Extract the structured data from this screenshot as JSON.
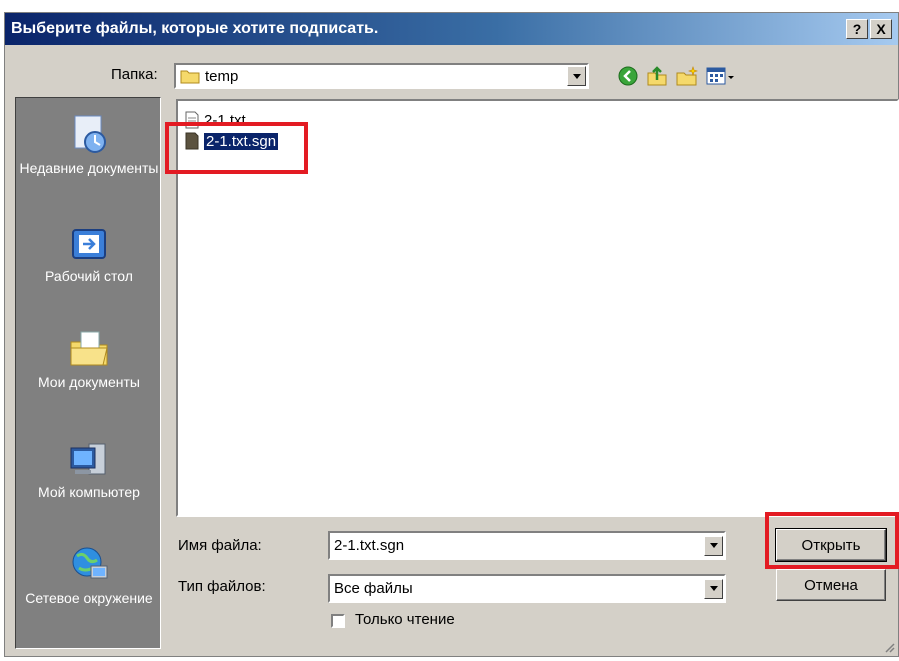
{
  "window": {
    "title": "Выберите файлы, которые хотите подписать.",
    "help": "?",
    "close": "X"
  },
  "toolbar": {
    "folder_label": "Папка:",
    "folder_value": "temp",
    "icons": [
      "back-icon",
      "up-folder-icon",
      "new-folder-icon",
      "view-menu-icon"
    ]
  },
  "places": [
    {
      "label": "Недавние документы",
      "icon": "recent-documents-icon"
    },
    {
      "label": "Рабочий стол",
      "icon": "desktop-icon"
    },
    {
      "label": "Мои документы",
      "icon": "my-documents-icon"
    },
    {
      "label": "Мой компьютер",
      "icon": "my-computer-icon"
    },
    {
      "label": "Сетевое окружение",
      "icon": "network-icon"
    }
  ],
  "files": [
    {
      "name": "2-1.txt",
      "selected": false
    },
    {
      "name": "2-1.txt.sgn",
      "selected": true
    }
  ],
  "form": {
    "filename_label": "Имя файла:",
    "filename_value": "2-1.txt.sgn",
    "filetype_label": "Тип файлов:",
    "filetype_value": "Все файлы",
    "readonly_label": "Только чтение",
    "readonly_checked": false
  },
  "buttons": {
    "open": "Открыть",
    "cancel": "Отмена"
  },
  "colors": {
    "highlight": "#e31b23",
    "selection": "#0a246a",
    "places_bg": "#808080",
    "dialog_bg": "#d4d0c8"
  }
}
